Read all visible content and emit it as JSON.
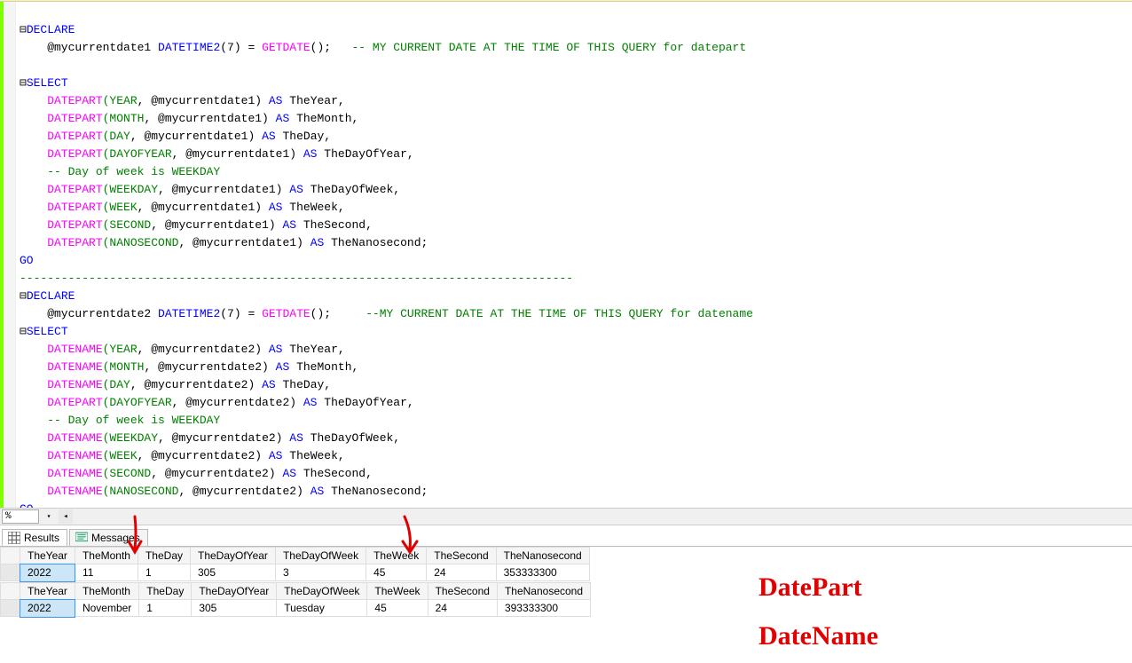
{
  "zoom": "%",
  "tabs": {
    "results": "Results",
    "messages": "Messages"
  },
  "code": {
    "l1_declare": "DECLARE",
    "l2_var": "    @mycurrentdate1 ",
    "l2_type": "DATETIME2",
    "l2_paren": "(7) = ",
    "l2_fn": "GETDATE",
    "l2_end": "();   ",
    "l2_comment": "-- MY CURRENT DATE AT THE TIME OF THIS QUERY for datepart",
    "l4_select": "SELECT",
    "l5a": "    DATEPART",
    "l5b": "(YEAR",
    "l5c": ", @mycurrentdate1) ",
    "l5d": "AS",
    "l5e": " TheYear,",
    "l6a": "    DATEPART",
    "l6b": "(MONTH",
    "l6c": ", @mycurrentdate1) ",
    "l6d": "AS",
    "l6e": " TheMonth,",
    "l7a": "    DATEPART",
    "l7b": "(DAY",
    "l7c": ", @mycurrentdate1) ",
    "l7d": "AS",
    "l7e": " TheDay,",
    "l8a": "    DATEPART",
    "l8b": "(DAYOFYEAR",
    "l8c": ", @mycurrentdate1) ",
    "l8d": "AS",
    "l8e": " TheDayOfYear,",
    "l9": "    -- Day of week is WEEKDAY",
    "l10a": "    DATEPART",
    "l10b": "(WEEKDAY",
    "l10c": ", @mycurrentdate1) ",
    "l10d": "AS",
    "l10e": " TheDayOfWeek,",
    "l11a": "    DATEPART",
    "l11b": "(WEEK",
    "l11c": ", @mycurrentdate1) ",
    "l11d": "AS",
    "l11e": " TheWeek,",
    "l12a": "    DATEPART",
    "l12b": "(SECOND",
    "l12c": ", @mycurrentdate1) ",
    "l12d": "AS",
    "l12e": " TheSecond,",
    "l13a": "    DATEPART",
    "l13b": "(NANOSECOND",
    "l13c": ", @mycurrentdate1) ",
    "l13d": "AS",
    "l13e": " TheNanosecond;",
    "l14": "GO",
    "dash": "--------------------------------------------------------------------------------",
    "l16_declare": "DECLARE",
    "l17_var": "    @mycurrentdate2 ",
    "l17_type": "DATETIME2",
    "l17_paren": "(7) = ",
    "l17_fn": "GETDATE",
    "l17_end": "();     ",
    "l17_comment": "--MY CURRENT DATE AT THE TIME OF THIS QUERY for datename",
    "l18_select": "SELECT",
    "l19a": "    DATENAME",
    "l19b": "(YEAR",
    "l19c": ", @mycurrentdate2) ",
    "l19d": "AS",
    "l19e": " TheYear,",
    "l20a": "    DATENAME",
    "l20b": "(MONTH",
    "l20c": ", @mycurrentdate2) ",
    "l20d": "AS",
    "l20e": " TheMonth,",
    "l21a": "    DATENAME",
    "l21b": "(DAY",
    "l21c": ", @mycurrentdate2) ",
    "l21d": "AS",
    "l21e": " TheDay,",
    "l22a": "    DATEPART",
    "l22b": "(DAYOFYEAR",
    "l22c": ", @mycurrentdate2) ",
    "l22d": "AS",
    "l22e": " TheDayOfYear,",
    "l23": "    -- Day of week is WEEKDAY",
    "l24a": "    DATENAME",
    "l24b": "(WEEKDAY",
    "l24c": ", @mycurrentdate2) ",
    "l24d": "AS",
    "l24e": " TheDayOfWeek,",
    "l25a": "    DATENAME",
    "l25b": "(WEEK",
    "l25c": ", @mycurrentdate2) ",
    "l25d": "AS",
    "l25e": " TheWeek,",
    "l26a": "    DATENAME",
    "l26b": "(SECOND",
    "l26c": ", @mycurrentdate2) ",
    "l26d": "AS",
    "l26e": " TheSecond,",
    "l27a": "    DATENAME",
    "l27b": "(NANOSECOND",
    "l27c": ", @mycurrentdate2) ",
    "l27d": "AS",
    "l27e": " TheNanosecond;",
    "l28": "GO"
  },
  "results": {
    "headers": [
      "TheYear",
      "TheMonth",
      "TheDay",
      "TheDayOfYear",
      "TheDayOfWeek",
      "TheWeek",
      "TheSecond",
      "TheNanosecond"
    ],
    "set1": [
      [
        "2022",
        "11",
        "1",
        "305",
        "3",
        "45",
        "24",
        "353333300"
      ]
    ],
    "set2": [
      [
        "2022",
        "November",
        "1",
        "305",
        "Tuesday",
        "45",
        "24",
        "393333300"
      ]
    ]
  },
  "annotations": {
    "datepart": "DatePart",
    "datename": "DateName"
  }
}
